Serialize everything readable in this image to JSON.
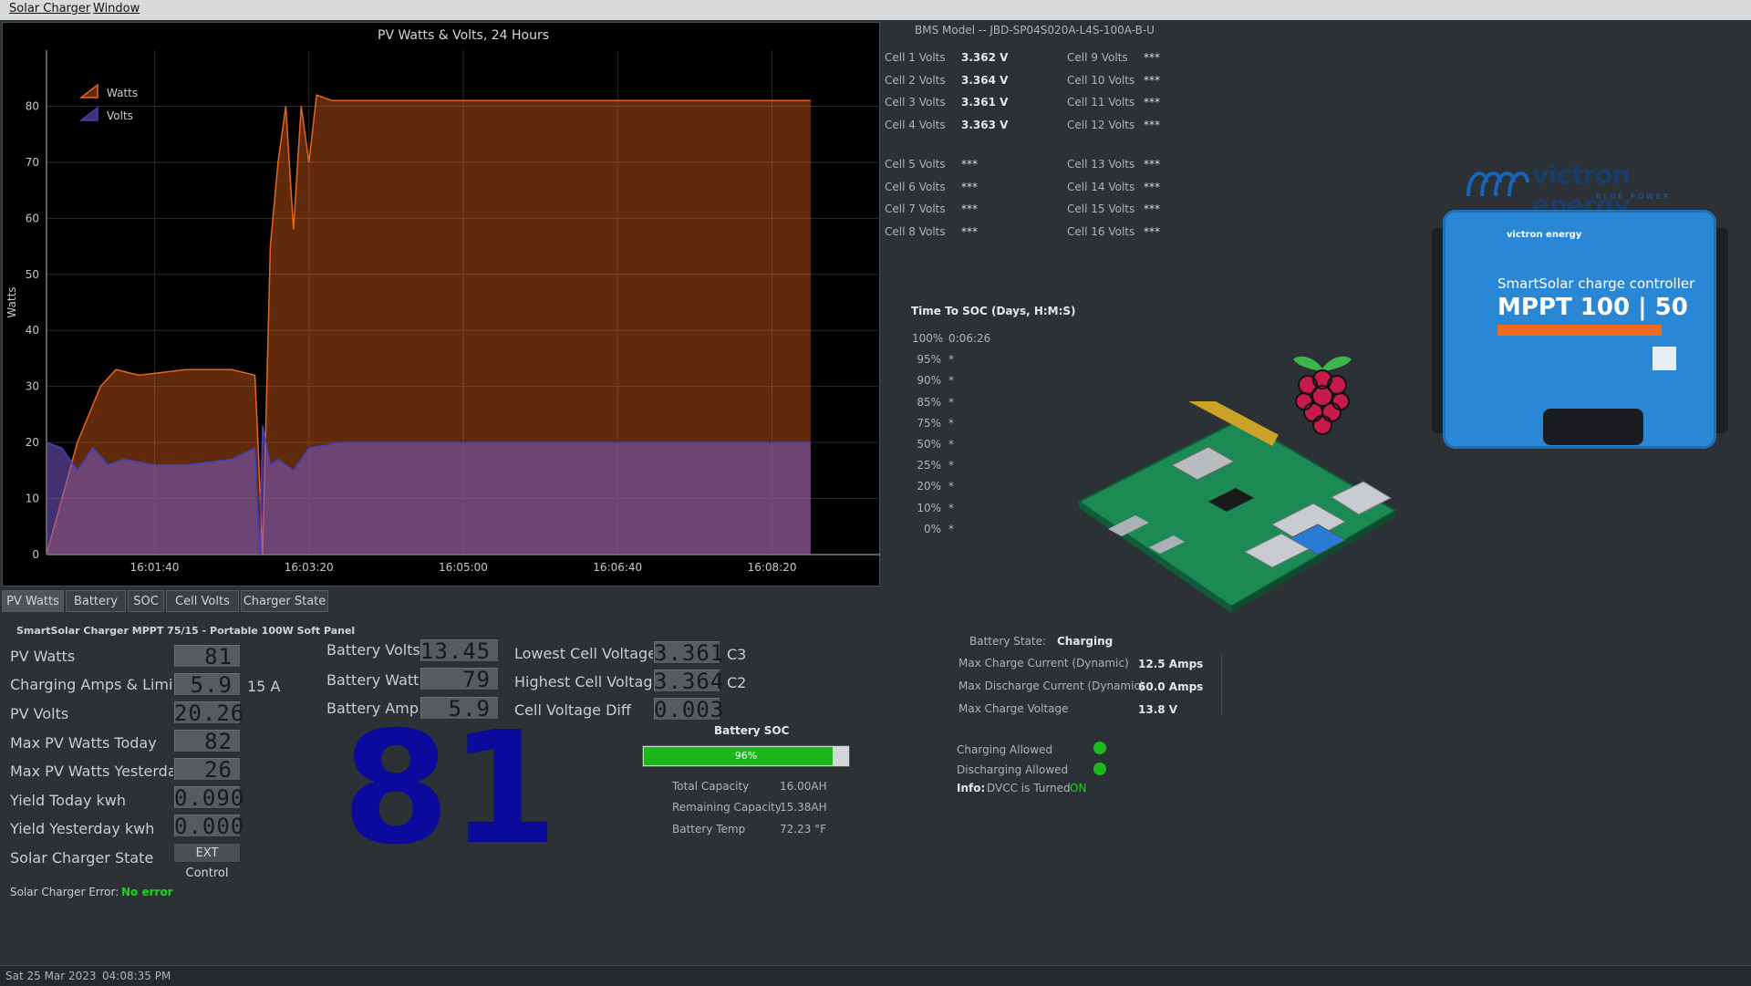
{
  "menu": {
    "items": [
      "Solar Charger",
      "Window"
    ]
  },
  "chart_data": {
    "type": "area",
    "title": "PV Watts & Volts, 24 Hours",
    "ylabel": "Watts",
    "xlabel": "",
    "ylim": [
      0,
      90
    ],
    "xlim": [
      "16:00:30",
      "16:09:30"
    ],
    "y_ticks": [
      "0",
      "10",
      "20",
      "30",
      "40",
      "50",
      "60",
      "70",
      "80"
    ],
    "x_ticks": [
      "16:01:40",
      "16:03:20",
      "16:05:00",
      "16:06:40",
      "16:08:20"
    ],
    "legend_position": "top-left",
    "grid": true,
    "series": [
      {
        "name": "Watts",
        "color": "#e8641e",
        "x": [
          "16:00:30",
          "16:00:50",
          "16:01:05",
          "16:01:15",
          "16:01:30",
          "16:02:00",
          "16:02:30",
          "16:02:45",
          "16:02:47",
          "16:02:50",
          "16:02:55",
          "16:03:00",
          "16:03:05",
          "16:03:10",
          "16:03:15",
          "16:03:20",
          "16:03:25",
          "16:03:35",
          "16:04:00",
          "16:05:00",
          "16:06:00",
          "16:07:00",
          "16:08:00",
          "16:08:45"
        ],
        "values": [
          0,
          20,
          30,
          33,
          32,
          33,
          33,
          32,
          20,
          0,
          55,
          70,
          80,
          58,
          80,
          70,
          82,
          81,
          81,
          81,
          81,
          81,
          81,
          81
        ]
      },
      {
        "name": "Volts",
        "color": "#4040c0",
        "x": [
          "16:00:30",
          "16:00:40",
          "16:00:50",
          "16:01:00",
          "16:01:10",
          "16:01:20",
          "16:01:40",
          "16:02:00",
          "16:02:30",
          "16:02:45",
          "16:02:48",
          "16:02:50",
          "16:02:55",
          "16:03:00",
          "16:03:10",
          "16:03:20",
          "16:03:40",
          "16:04:00",
          "16:05:00",
          "16:06:00",
          "16:07:00",
          "16:08:00",
          "16:08:45"
        ],
        "values": [
          20,
          19,
          15,
          19,
          16,
          17,
          16,
          16,
          17,
          19,
          0,
          23,
          16,
          17,
          15,
          19,
          20,
          20,
          20,
          20,
          20,
          20,
          20
        ]
      }
    ]
  },
  "tabs": [
    "PV Watts",
    "Battery",
    "SOC",
    "Cell Volts",
    "Charger State"
  ],
  "charger": {
    "title": "SmartSolar Charger MPPT 75/15 - Portable 100W Soft Panel",
    "rows": [
      {
        "label": "PV Watts",
        "value": "81",
        "unit": ""
      },
      {
        "label": "Charging Amps & Limit",
        "value": "5.9",
        "unit": "15 A"
      },
      {
        "label": "PV Volts",
        "value": "20.26",
        "unit": ""
      },
      {
        "label": "Max PV Watts Today",
        "value": "82",
        "unit": ""
      },
      {
        "label": "Max PV Watts Yesterday",
        "value": "26",
        "unit": ""
      },
      {
        "label": "Yield Today kwh",
        "value": "0.090",
        "unit": ""
      },
      {
        "label": "Yield Yesterday kwh",
        "value": "0.000",
        "unit": ""
      },
      {
        "label": "Solar Charger State",
        "value": "EXT Control",
        "unit": ""
      }
    ],
    "error_label": "Solar Charger Error:",
    "error_value": "No error",
    "big_number": "81"
  },
  "battery": {
    "rows": [
      {
        "label": "Battery Volts",
        "value": "13.45"
      },
      {
        "label": "Battery Watts",
        "value": "79"
      },
      {
        "label": "Battery Amps",
        "value": "5.9"
      }
    ]
  },
  "cells_summary": {
    "rows": [
      {
        "label": "Lowest Cell Voltage",
        "value": "3.361",
        "cell": "C3"
      },
      {
        "label": "Highest Cell Voltage",
        "value": "3.364",
        "cell": "C2"
      },
      {
        "label": "Cell Voltage Diff",
        "value": "0.003",
        "cell": ""
      }
    ]
  },
  "soc": {
    "title": "Battery SOC",
    "percent": 96,
    "percent_label": "96%",
    "details": [
      {
        "label": "Total Capacity",
        "value": "16.00AH"
      },
      {
        "label": "Remaining Capacity",
        "value": "15.38AH"
      },
      {
        "label": "Battery Temp",
        "value": "72.23 °F"
      }
    ]
  },
  "bms": {
    "model": "BMS Model -- JBD-SP04S020A-L4S-100A-B-U",
    "cells_left": [
      {
        "label": "Cell 1 Volts",
        "value": "3.362 V"
      },
      {
        "label": "Cell 2 Volts",
        "value": "3.364 V"
      },
      {
        "label": "Cell 3 Volts",
        "value": "3.361 V"
      },
      {
        "label": "Cell 4 Volts",
        "value": "3.363 V"
      },
      {
        "label": "Cell 5 Volts",
        "value": "***"
      },
      {
        "label": "Cell 6 Volts",
        "value": "***"
      },
      {
        "label": "Cell 7 Volts",
        "value": "***"
      },
      {
        "label": "Cell 8 Volts",
        "value": "***"
      }
    ],
    "cells_right": [
      {
        "label": "Cell 9 Volts",
        "value": "***"
      },
      {
        "label": "Cell 10 Volts",
        "value": "***"
      },
      {
        "label": "Cell 11 Volts",
        "value": "***"
      },
      {
        "label": "Cell 12 Volts",
        "value": "***"
      },
      {
        "label": "Cell 13 Volts",
        "value": "***"
      },
      {
        "label": "Cell 14 Volts",
        "value": "***"
      },
      {
        "label": "Cell 15 Volts",
        "value": "***"
      },
      {
        "label": "Cell 16 Volts",
        "value": "***"
      }
    ]
  },
  "time_to_soc": {
    "title": "Time To SOC  (Days, H:M:S)",
    "rows": [
      {
        "pct": "100%",
        "value": "0:06:26"
      },
      {
        "pct": "95%",
        "value": "*"
      },
      {
        "pct": "90%",
        "value": "*"
      },
      {
        "pct": "85%",
        "value": "*"
      },
      {
        "pct": "75%",
        "value": "*"
      },
      {
        "pct": "50%",
        "value": "*"
      },
      {
        "pct": "25%",
        "value": "*"
      },
      {
        "pct": "20%",
        "value": "*"
      },
      {
        "pct": "10%",
        "value": "*"
      },
      {
        "pct": "0%",
        "value": "*"
      }
    ]
  },
  "battery_state": {
    "label": "Battery State:",
    "value": "Charging",
    "rows": [
      {
        "label": "Max Charge Current (Dynamic)",
        "value": "12.5 Amps"
      },
      {
        "label": "Max Discharge Current (Dynamic)",
        "value": "60.0 Amps"
      },
      {
        "label": "Max Charge Voltage",
        "value": "13.8 V"
      }
    ],
    "flags": [
      {
        "label": "Charging Allowed"
      },
      {
        "label": "Discharging Allowed"
      }
    ],
    "info_prefix": "Info:",
    "info_text": "DVCC is Turned",
    "info_value": "ON"
  },
  "victron": {
    "brand": "victron energy",
    "tagline": "BLUE POWER",
    "product_line": "SmartSolar charge controller",
    "model": "MPPT 100 | 50",
    "badge_small": "victron energy"
  },
  "statusbar": {
    "date": "Sat 25 Mar 2023",
    "time": "04:08:35 PM"
  },
  "colors": {
    "accent_green": "#1cd41c",
    "soc_bar": "#1ab81a",
    "big_number": "#0a0a9c"
  }
}
